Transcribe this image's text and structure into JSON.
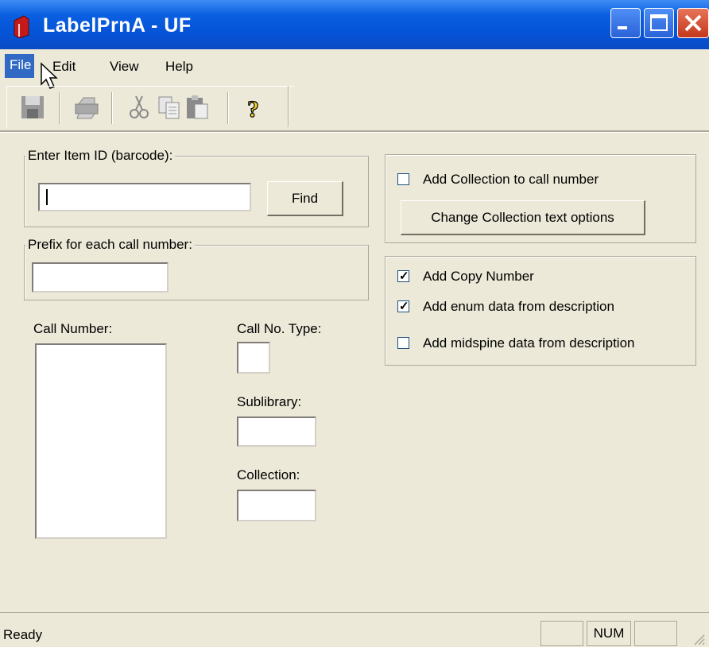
{
  "window": {
    "title": "LabelPrnA - UF"
  },
  "menu": {
    "items": [
      "File",
      "Edit",
      "View",
      "Help"
    ]
  },
  "toolbar": {
    "icons": [
      "save-icon",
      "print-icon",
      "cut-icon",
      "copy-icon",
      "paste-icon",
      "help-icon"
    ]
  },
  "item_id": {
    "label": "Enter Item ID (barcode):",
    "value": "",
    "find_label": "Find"
  },
  "prefix": {
    "label": "Prefix for each call number:",
    "value": ""
  },
  "call_number": {
    "label": "Call Number:",
    "value": ""
  },
  "call_no_type": {
    "label": "Call No. Type:",
    "value": ""
  },
  "sublibrary": {
    "label": "Sublibrary:",
    "value": ""
  },
  "collection": {
    "label": "Collection:",
    "value": ""
  },
  "collection_options": {
    "add_collection_label": "Add Collection to call number",
    "add_collection_checked": false,
    "change_button_label": "Change Collection text options"
  },
  "options": [
    {
      "label": "Add Copy Number",
      "checked": true
    },
    {
      "label": "Add enum data from description",
      "checked": true
    },
    {
      "label": "Add midspine data from description",
      "checked": false
    }
  ],
  "status": {
    "text": "Ready",
    "num": "NUM"
  }
}
